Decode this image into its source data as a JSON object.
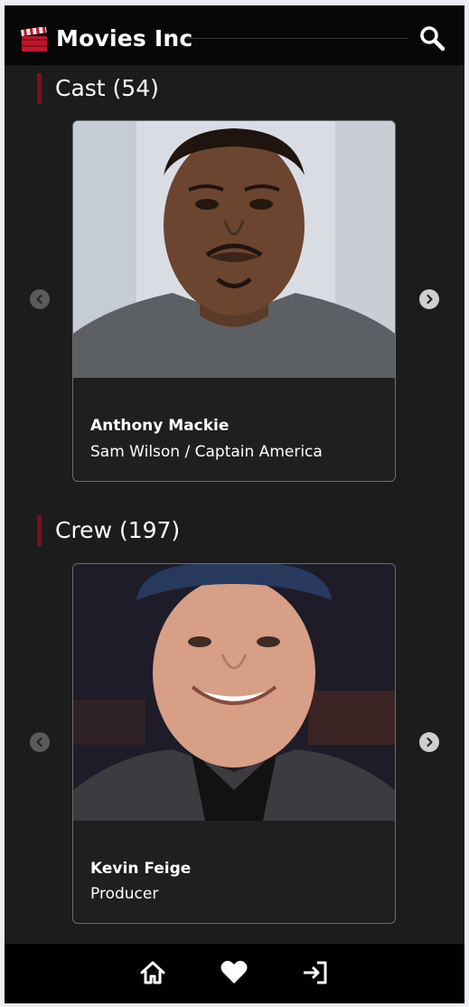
{
  "header": {
    "brand": "Movies Inc",
    "logo_icon": "clapperboard-icon",
    "search_icon": "search-icon"
  },
  "cast": {
    "title": "Cast (54)",
    "card": {
      "name": "Anthony Mackie",
      "role": "Sam Wilson / Captain America"
    }
  },
  "crew": {
    "title": "Crew (197)",
    "card": {
      "name": "Kevin Feige",
      "role": "Producer"
    }
  },
  "carousel": {
    "prev_icon": "chevron-left-icon",
    "next_icon": "chevron-right-icon"
  },
  "nav": {
    "items": [
      "home-icon",
      "heart-icon",
      "sign-in-icon"
    ]
  },
  "colors": {
    "accent": "#7b1020",
    "background": "#1c1c1c",
    "header": "#070707"
  }
}
